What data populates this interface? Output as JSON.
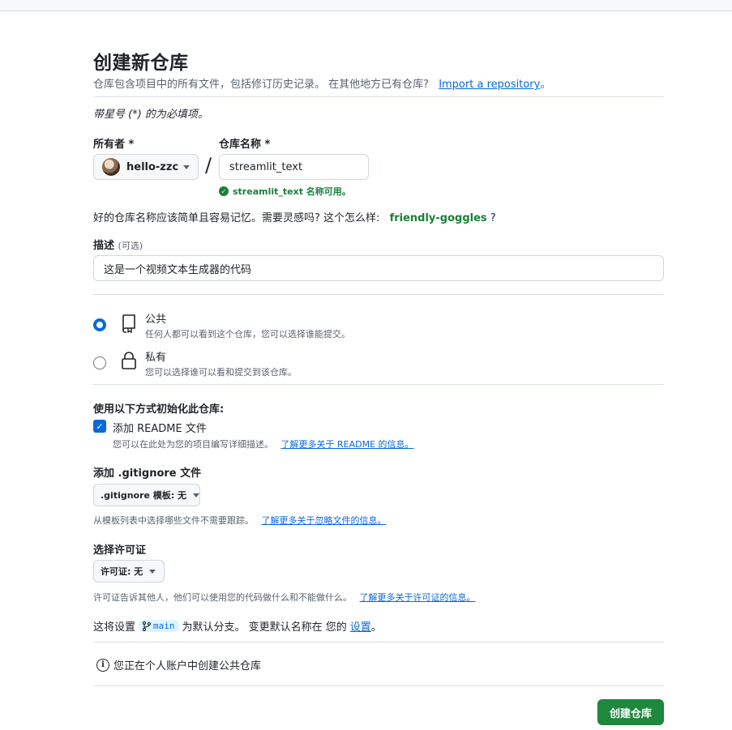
{
  "header": {
    "title": "创建新仓库",
    "subtitle": "仓库包含项目中的所有文件，包括修订历史记录。 在其他地方已有仓库?",
    "import_link": "Import a repository",
    "import_suffix": "。"
  },
  "form": {
    "required_note": "带星号 (*) 的为必填项。",
    "owner": {
      "label": "所有者 *",
      "value": "hello-zzc"
    },
    "separator": "/",
    "repo_name": {
      "label": "仓库名称 *",
      "value": "streamlit_text",
      "valid_message": "streamlit_text 名称可用。"
    },
    "suggestion": {
      "text": "好的仓库名称应该简单且容易记忆。需要灵感吗? 这个怎么样:",
      "name": "friendly-goggles",
      "suffix": "?"
    },
    "description": {
      "label": "描述",
      "optional": "(可选)",
      "value": "这是一个视频文本生成器的代码"
    },
    "visibility": {
      "public": {
        "title": "公共",
        "desc": "任何人都可以看到这个仓库，您可以选择谁能提交。"
      },
      "private": {
        "title": "私有",
        "desc": "您可以选择谁可以看和提交到该仓库。"
      }
    },
    "init": {
      "heading": "使用以下方式初始化此仓库:",
      "readme_label": "添加 README 文件",
      "readme_desc": "您可以在此处为您的项目编写详细描述。",
      "readme_link": "了解更多关于 README 的信息。"
    },
    "gitignore": {
      "heading": "添加 .gitignore 文件",
      "select": ".gitignore 模板: 无",
      "desc": "从模板列表中选择哪些文件不需要跟踪。",
      "link": "了解更多关于忽略文件的信息。"
    },
    "license": {
      "heading": "选择许可证",
      "select": "许可证: 无",
      "desc": "许可证告诉其他人，他们可以使用您的代码做什么和不能做什么。",
      "link": "了解更多关于许可证的信息。"
    },
    "branch": {
      "prefix": "这将设置",
      "name": "main",
      "middle": "为默认分支。 变更默认名称在 您的",
      "link": "设置",
      "suffix": "。"
    },
    "info": "您正在个人账户中创建公共仓库",
    "submit": "创建仓库"
  },
  "colors": {
    "accent": "#0969da",
    "success": "#1a7f37",
    "button": "#1f883d"
  }
}
